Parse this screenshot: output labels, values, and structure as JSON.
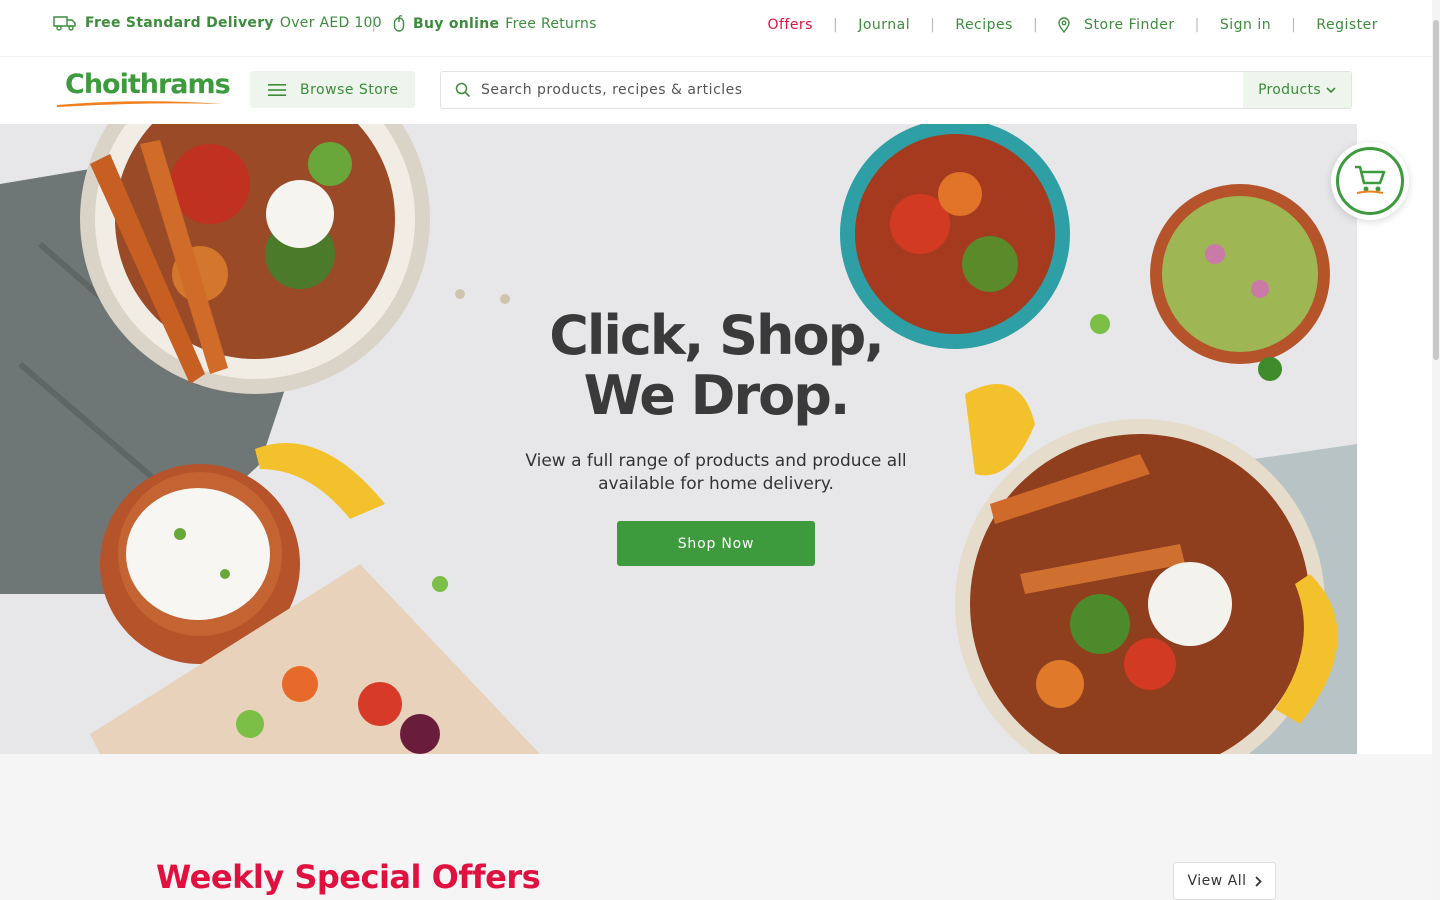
{
  "promo": {
    "delivery_bold": "Free Standard Delivery",
    "delivery_rest": "Over AED 100",
    "separator": "|",
    "online_bold": "Buy online",
    "online_rest": "Free Returns"
  },
  "toplinks": {
    "offers": "Offers",
    "journal": "Journal",
    "recipes": "Recipes",
    "store_finder": "Store Finder",
    "sign_in": "Sign in",
    "register": "Register",
    "separator": "|"
  },
  "header": {
    "logo": "Choithrams",
    "browse_label": "Browse Store",
    "search_placeholder": "Search products, recipes & articles",
    "search_scope": "Products"
  },
  "hero": {
    "title": "Click, Shop, We Drop.",
    "subtitle": "View a full range of products and produce all available for home delivery.",
    "cta": "Shop Now"
  },
  "offers_section": {
    "title": "Weekly Special Offers",
    "view_all": "View All"
  },
  "colors": {
    "brand_green": "#3d9a3d",
    "accent_red": "#e0113f",
    "hero_bg": "#e7e7ea"
  },
  "icons": {
    "delivery": "delivery-truck-icon",
    "returns": "mouse-icon",
    "store": "map-pin-icon",
    "menu": "hamburger-icon",
    "search": "search-icon",
    "cart": "shopping-cart-icon",
    "dropdown": "chevron-down-icon",
    "view_all": "chevron-right-icon"
  }
}
